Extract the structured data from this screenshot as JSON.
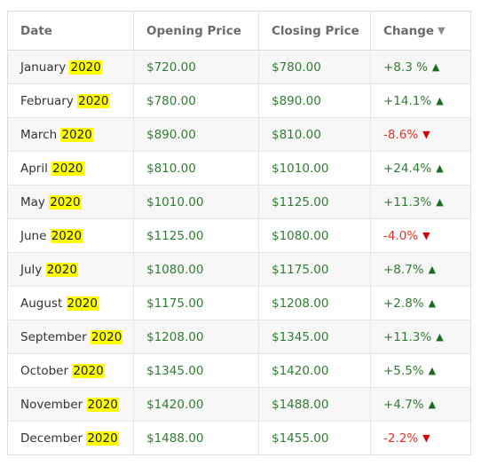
{
  "table": {
    "name": "monthly-stock-price-table",
    "columns": [
      {
        "key": "date",
        "label": "Date",
        "sort_indicator": ""
      },
      {
        "key": "open",
        "label": "Opening Price",
        "sort_indicator": ""
      },
      {
        "key": "close",
        "label": "Closing Price",
        "sort_indicator": ""
      },
      {
        "key": "change",
        "label": "Change",
        "sort_indicator": "▼"
      }
    ],
    "highlight_term": "2020",
    "highlight_color": "#ffff00",
    "colors": {
      "header_text": "#6b6b6b",
      "date_text": "#333333",
      "price_text": "#2f7d32",
      "positive": "#2f7d32",
      "negative": "#ee3124",
      "up_arrow": "#1b6b20",
      "down_arrow": "#d40000",
      "row_odd_bg": "#f7f7f7",
      "row_even_bg": "#ffffff",
      "border": "#e6e6e6"
    },
    "rows": [
      {
        "month": "January",
        "year": "2020",
        "open": "$720.00",
        "close": "$780.00",
        "change": "+8.3 %",
        "arrow": "▲",
        "direction": "up"
      },
      {
        "month": "February",
        "year": "2020",
        "open": "$780.00",
        "close": "$890.00",
        "change": "+14.1%",
        "arrow": "▲",
        "direction": "up"
      },
      {
        "month": "March",
        "year": "2020",
        "open": "$890.00",
        "close": "$810.00",
        "change": "-8.6%",
        "arrow": "▼",
        "direction": "down"
      },
      {
        "month": "April",
        "year": "2020",
        "open": "$810.00",
        "close": "$1010.00",
        "change": "+24.4%",
        "arrow": "▲",
        "direction": "up"
      },
      {
        "month": "May",
        "year": "2020",
        "open": "$1010.00",
        "close": "$1125.00",
        "change": "+11.3%",
        "arrow": "▲",
        "direction": "up"
      },
      {
        "month": "June",
        "year": "2020",
        "open": "$1125.00",
        "close": "$1080.00",
        "change": "-4.0%",
        "arrow": "▼",
        "direction": "down"
      },
      {
        "month": "July",
        "year": "2020",
        "open": "$1080.00",
        "close": "$1175.00",
        "change": "+8.7%",
        "arrow": "▲",
        "direction": "up"
      },
      {
        "month": "August",
        "year": "2020",
        "open": "$1175.00",
        "close": "$1208.00",
        "change": "+2.8%",
        "arrow": "▲",
        "direction": "up"
      },
      {
        "month": "September",
        "year": "2020",
        "open": "$1208.00",
        "close": "$1345.00",
        "change": "+11.3%",
        "arrow": "▲",
        "direction": "up"
      },
      {
        "month": "October",
        "year": "2020",
        "open": "$1345.00",
        "close": "$1420.00",
        "change": "+5.5%",
        "arrow": "▲",
        "direction": "up"
      },
      {
        "month": "November",
        "year": "2020",
        "open": "$1420.00",
        "close": "$1488.00",
        "change": "+4.7%",
        "arrow": "▲",
        "direction": "up"
      },
      {
        "month": "December",
        "year": "2020",
        "open": "$1488.00",
        "close": "$1455.00",
        "change": "-2.2%",
        "arrow": "▼",
        "direction": "down"
      }
    ]
  }
}
